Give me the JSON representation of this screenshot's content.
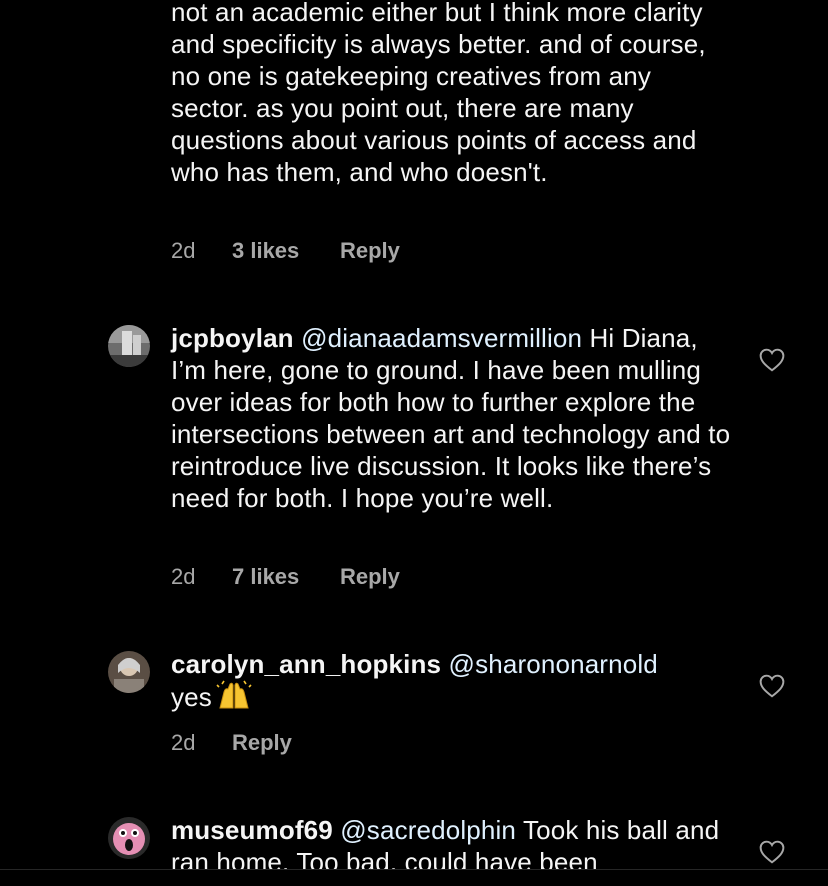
{
  "comments": [
    {
      "id": "c0",
      "text": "not an academic either but I think more clarity and specificity is always better. and of course, no one is gatekeeping creatives from any sector. as you point out, there are many questions about various points of access and who has them, and who doesn't.",
      "time": "2d",
      "likes": "3 likes",
      "reply": "Reply"
    },
    {
      "id": "c1",
      "username": "jcpboylan",
      "mention": "@dianaadamsvermillion",
      "text": " Hi Diana, I’m here, gone to ground. I have been mulling over ideas for both how to further explore the intersections between art and technology and to reintroduce live discussion. It looks like there’s need for both. I hope you’re well.",
      "time": "2d",
      "likes": "7 likes",
      "reply": "Reply"
    },
    {
      "id": "c2",
      "username": "carolyn_ann_hopkins",
      "mention": "@sharononarnold",
      "text": "yes",
      "emoji": "raised-hands-emoji",
      "time": "2d",
      "reply": "Reply"
    },
    {
      "id": "c3",
      "username": "museumof69",
      "mention": "@sacredolphin",
      "text": " Took his ball and ran home. Too bad, could have been"
    }
  ],
  "colors": {
    "background": "#000000",
    "primary_text": "#f5f5f5",
    "secondary_text": "#a8a8a8",
    "mention": "#e0f1ff"
  },
  "icons": {
    "like": "heart-outline-icon"
  }
}
